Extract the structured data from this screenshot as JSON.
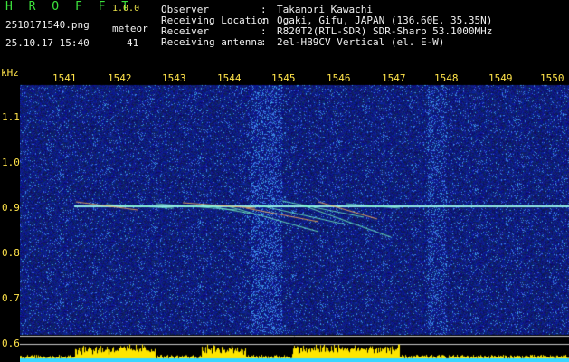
{
  "header": {
    "app_name": "H R O F F T",
    "version": "1.0.0",
    "filename": "2510171540.png",
    "datetime": "25.10.17 15:40",
    "meteor_label": "meteor",
    "meteor_count": "41",
    "fields": [
      {
        "label": "Observer",
        "value": "Takanori Kawachi"
      },
      {
        "label": "Receiving Location",
        "value": "Ogaki, Gifu, JAPAN (136.60E, 35.35N)"
      },
      {
        "label": "Receiver",
        "value": "R820T2(RTL-SDR) SDR-Sharp 53.1000MHz"
      },
      {
        "label": "Receiving antenna",
        "value": "2el-HB9CV Vertical (el. E-W)"
      }
    ]
  },
  "axes": {
    "y_unit": "kHz",
    "y_ticks": [
      "1.1",
      "1.0",
      "0.9",
      "0.8",
      "0.7",
      "0.6"
    ],
    "x_ticks": [
      "1541",
      "1542",
      "1543",
      "1544",
      "1545",
      "1546",
      "1547",
      "1548",
      "1549",
      "1550"
    ]
  },
  "colors": {
    "background": "#000000",
    "noise_floor": "#0a1a78",
    "signal": "#7fffe0",
    "label": "#ffe34a",
    "level_bar": "#ffe600"
  }
}
